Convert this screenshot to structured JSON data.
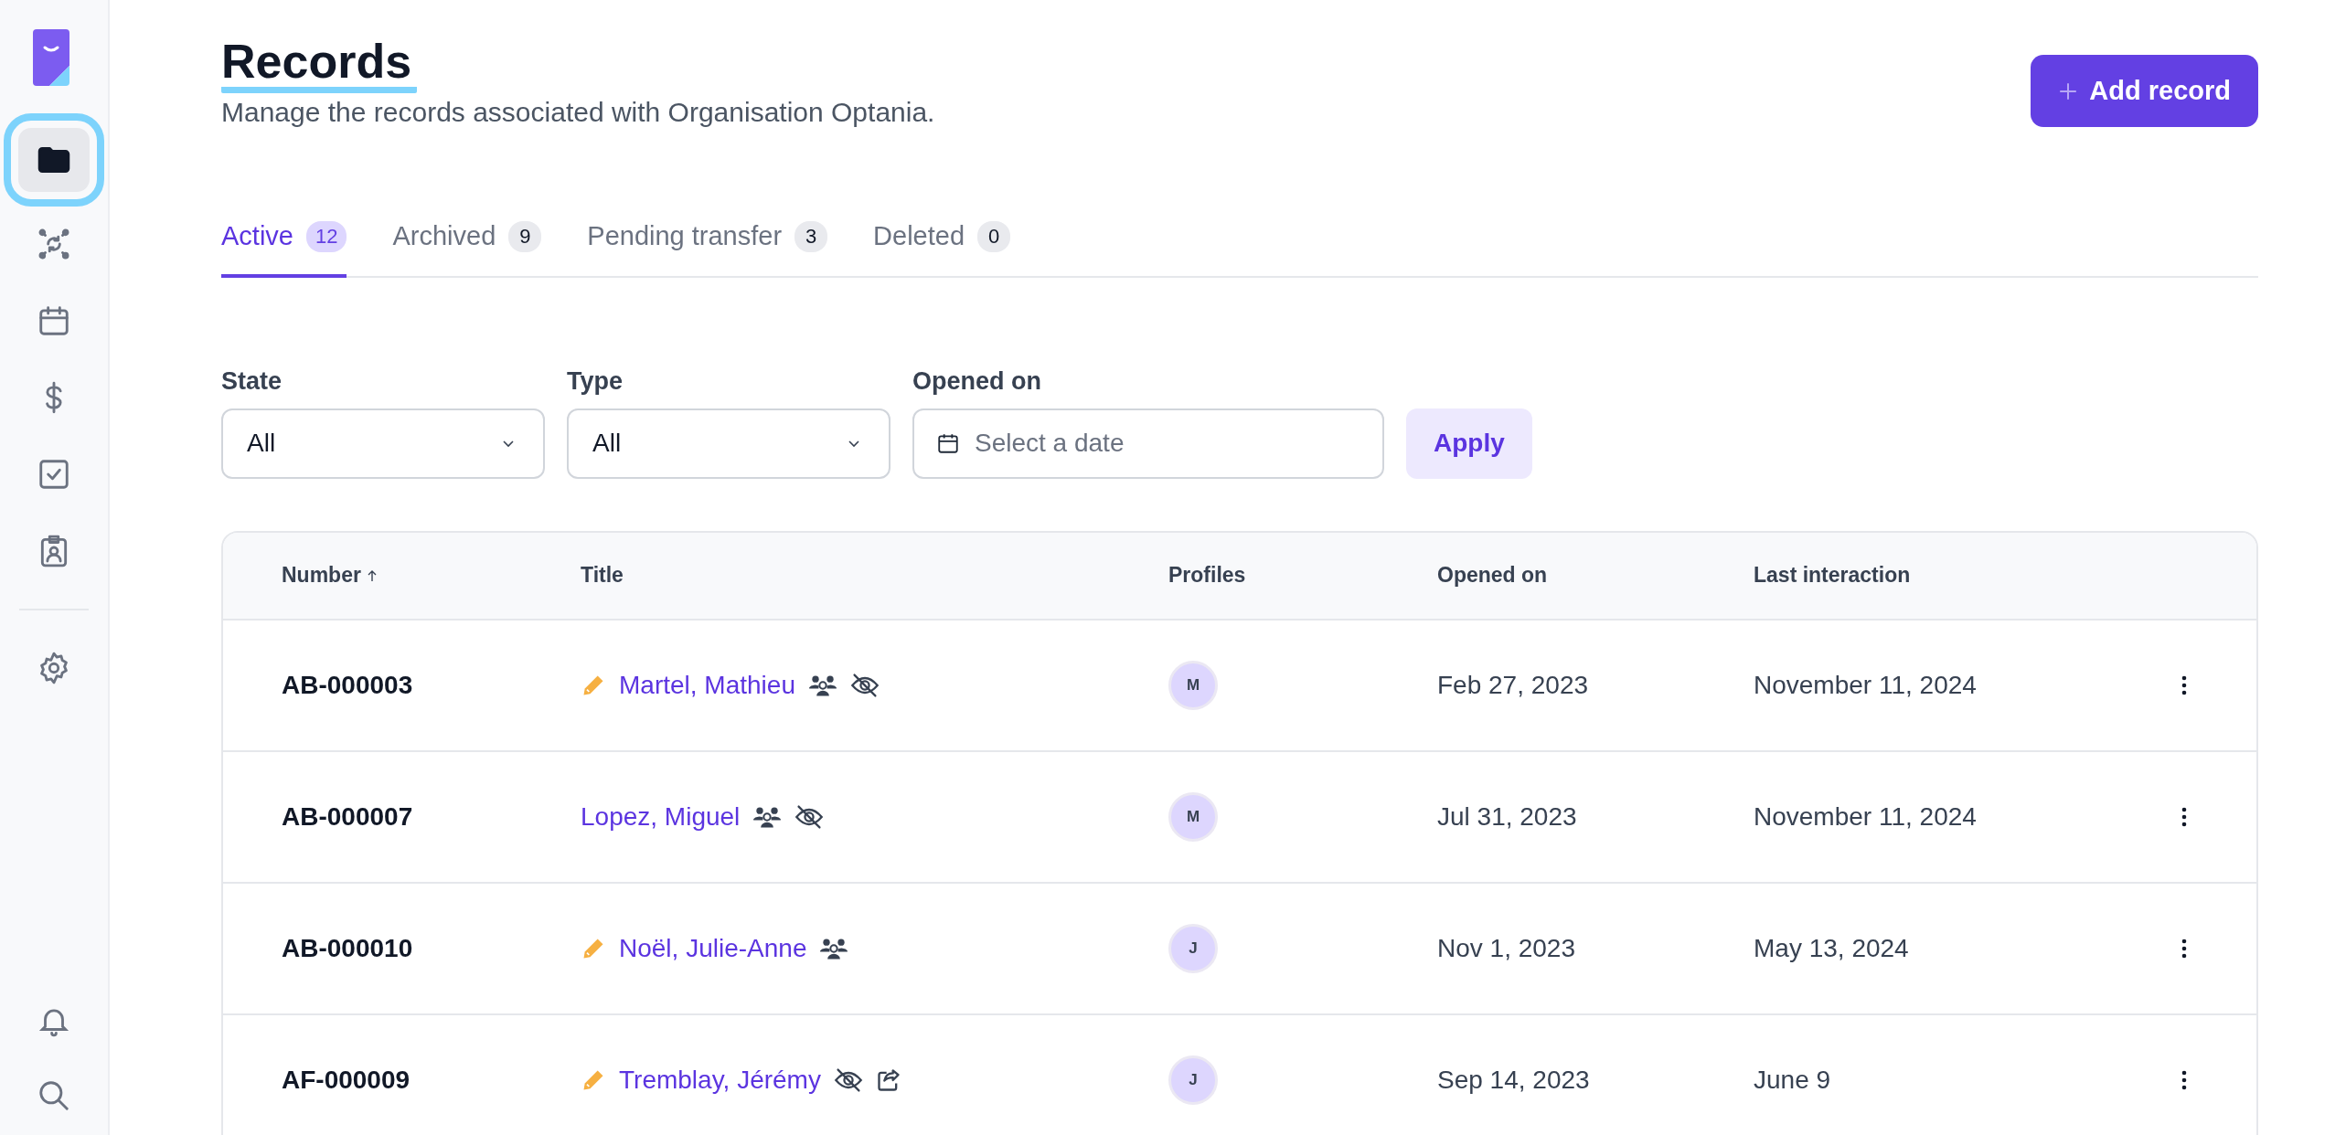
{
  "sidebar": {
    "items": [
      {
        "selected": true
      },
      {
        "selected": false
      },
      {
        "selected": false
      },
      {
        "selected": false
      },
      {
        "selected": false
      },
      {
        "selected": false
      },
      {
        "selected": false
      }
    ]
  },
  "header": {
    "title": "Records",
    "subtitle": "Manage the records associated with Organisation Optania.",
    "add_button": "Add record"
  },
  "tabs": [
    {
      "label": "Active",
      "count": "12",
      "selected": true
    },
    {
      "label": "Archived",
      "count": "9",
      "selected": false
    },
    {
      "label": "Pending transfer",
      "count": "3",
      "selected": false
    },
    {
      "label": "Deleted",
      "count": "0",
      "selected": false
    }
  ],
  "filters": [
    {
      "kind": "select",
      "label": "State",
      "value": "All"
    },
    {
      "kind": "select",
      "label": "Type",
      "value": "All"
    },
    {
      "kind": "date",
      "label": "Opened on",
      "placeholder": "Select a date"
    }
  ],
  "apply_button": "Apply",
  "table": {
    "columns": [
      {
        "label": "Number",
        "sorted": true
      },
      {
        "label": "Title",
        "sorted": false
      },
      {
        "label": "Profiles",
        "sorted": false
      },
      {
        "label": "Opened on",
        "sorted": false
      },
      {
        "label": "Last interaction",
        "sorted": false
      }
    ],
    "rows": [
      {
        "number": "AB-000003",
        "editing": true,
        "title": "Martel, Mathieu",
        "group": true,
        "hidden": true,
        "shared": false,
        "profile": "M",
        "opened_on": "Feb 27, 2023",
        "last_interaction": "November 11, 2024"
      },
      {
        "number": "AB-000007",
        "editing": false,
        "title": "Lopez, Miguel",
        "group": true,
        "hidden": true,
        "shared": false,
        "profile": "M",
        "opened_on": "Jul 31, 2023",
        "last_interaction": "November 11, 2024"
      },
      {
        "number": "AB-000010",
        "editing": true,
        "title": "Noël, Julie-Anne",
        "group": true,
        "hidden": false,
        "shared": false,
        "profile": "J",
        "opened_on": "Nov 1, 2023",
        "last_interaction": "May 13, 2024"
      },
      {
        "number": "AF-000009",
        "editing": true,
        "title": "Tremblay, Jérémy",
        "group": false,
        "hidden": true,
        "shared": true,
        "profile": "J",
        "opened_on": "Sep 14, 2023",
        "last_interaction": "June 9"
      }
    ]
  }
}
